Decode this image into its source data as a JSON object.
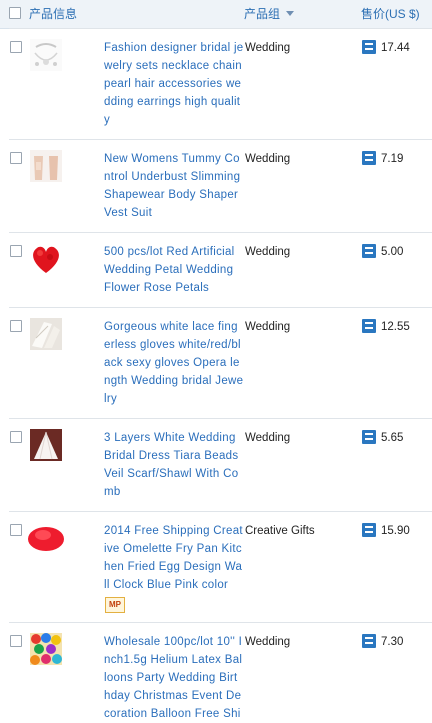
{
  "header": {
    "product_info": "产品信息",
    "product_group": "产品组",
    "price": "售价(US $)"
  },
  "products": [
    {
      "title": "Fashion designer bridal jewelry sets necklace chain pearl hair accessories wedding earrings high quality",
      "group": "Wedding",
      "price": "17.44"
    },
    {
      "title": "New Womens Tummy Control Underbust Slimming Shapewear Body Shaper Vest Suit",
      "group": "Wedding",
      "price": "7.19"
    },
    {
      "title": "500 pcs/lot Red Artificial Wedding Petal Wedding Flower Rose Petals",
      "group": "Wedding",
      "price": "5.00"
    },
    {
      "title": "Gorgeous white lace fingerless gloves white/red/black sexy gloves Opera length Wedding bridal Jewelry",
      "group": "Wedding",
      "price": "12.55"
    },
    {
      "title": "3 Layers White Wedding Bridal Dress Tiara Beads Veil Scarf/Shawl With Comb",
      "group": "Wedding",
      "price": "5.65"
    },
    {
      "title": "2014 Free Shipping Creative Omelette Fry Pan Kitchen Fried Egg Design Wall Clock Blue Pink color",
      "group": "Creative Gifts",
      "price": "15.90",
      "badge": "MP"
    },
    {
      "title": "Wholesale 100pc/lot 10'' Inch1.5g Helium Latex Balloons Party Wedding Birthday Christmas Event Decoration Balloon Free Shi",
      "group": "Wedding",
      "price": "7.30"
    }
  ]
}
